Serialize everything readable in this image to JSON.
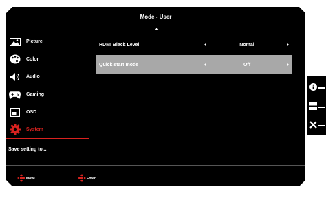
{
  "osd": {
    "title": "Mode - User",
    "sidebar": {
      "items": [
        {
          "label": "Picture",
          "icon": "picture-icon",
          "active": false
        },
        {
          "label": "Color",
          "icon": "color-icon",
          "active": false
        },
        {
          "label": "Audio",
          "icon": "speaker-icon",
          "active": false
        },
        {
          "label": "Gaming",
          "icon": "gamepad-icon",
          "active": false
        },
        {
          "label": "OSD",
          "icon": "osd-icon",
          "active": false
        },
        {
          "label": "System",
          "icon": "gear-icon",
          "active": true
        }
      ],
      "save_label": "Save setting to..."
    },
    "settings": [
      {
        "label": "HDMI Black Level",
        "value": "Nomal",
        "selected": false
      },
      {
        "label": "Quick start mode",
        "value": "Off",
        "selected": true
      }
    ],
    "hints": {
      "move": "Move",
      "enter": "Enter"
    },
    "colors": {
      "background": "#000000",
      "accent": "#d9221f",
      "selection": "#a8a8a8",
      "text": "#ffffff"
    }
  },
  "hotkeys": [
    {
      "icon": "info-icon"
    },
    {
      "icon": "input-icon"
    },
    {
      "icon": "close-icon"
    }
  ]
}
